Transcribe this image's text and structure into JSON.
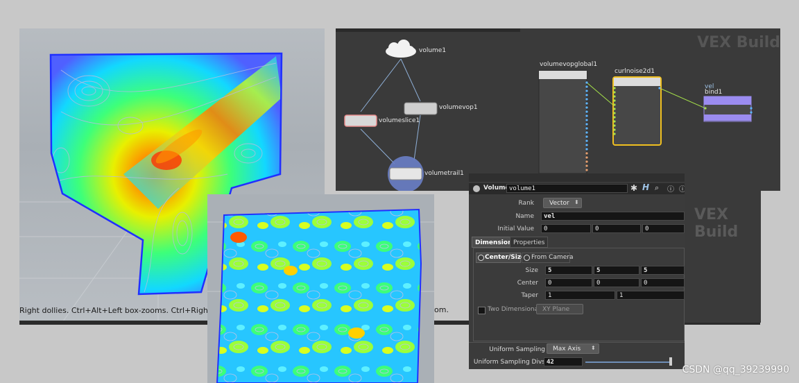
{
  "viewport_top": {
    "hint_text": "Right dollies. Ctrl+Alt+Left box-zooms. Ctrl+Right zooms"
  },
  "hint_tail": "om.",
  "network": {
    "watermark": "VEX Build",
    "nodes": {
      "volume1": "volume1",
      "volumeslice1": "volumeslice1",
      "volumevop1": "volumevop1",
      "volumetrail1": "volumetrail1",
      "volumevopglobal1": "volumevopglobal1",
      "curlnoise2d1": "curlnoise2d1",
      "bind_tag": "vel",
      "bind1": "bind1"
    }
  },
  "params": {
    "node_type": "Volume",
    "node_name": "volume1",
    "rank_label": "Rank",
    "rank_value": "Vector",
    "name_label": "Name",
    "name_value": "vel",
    "initial_label": "Initial Value",
    "initial_values": [
      "0",
      "0",
      "0"
    ],
    "tabs": [
      "Dimensions",
      "Properties"
    ],
    "center_size_option": "Center/Size",
    "from_camera_option": "From Camera",
    "size_label": "Size",
    "size_values": [
      "5",
      "5",
      "5"
    ],
    "center_label": "Center",
    "center_values": [
      "0",
      "0",
      "0"
    ],
    "taper_label": "Taper",
    "taper_values": [
      "1",
      "1"
    ],
    "two_dim_label": "Two Dimensional",
    "plane_value": "XY Plane",
    "uniform_label": "Uniform Sampling",
    "uniform_value": "Max Axis",
    "divs_label": "Uniform Sampling Divs",
    "divs_value": "42"
  },
  "right_pane": {
    "watermark": "VEX Build"
  },
  "credit": "CSDN @qq_39239990",
  "colors": {
    "node_selected": "#f0c020",
    "bind_node": "#9b8cf0",
    "wire": "#8fb0d8",
    "param_bg": "#3b3b3b"
  }
}
